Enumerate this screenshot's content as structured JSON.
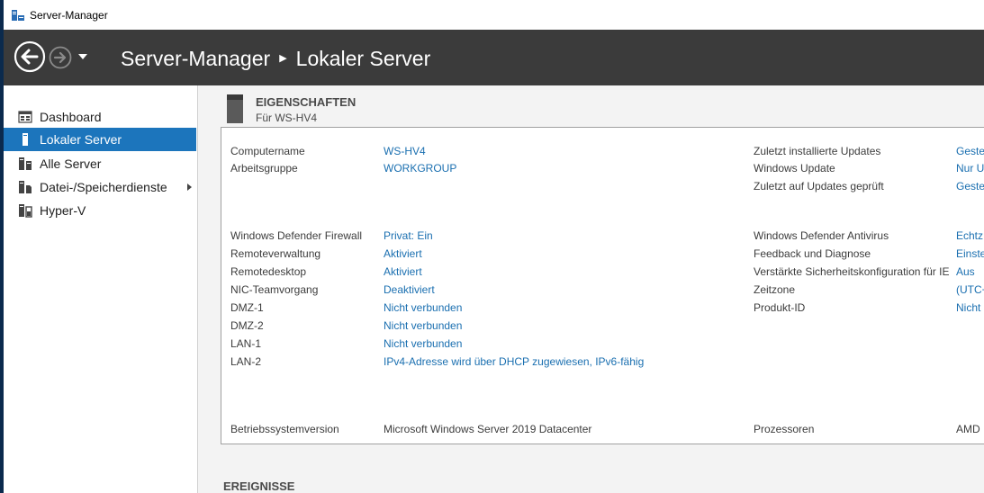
{
  "window": {
    "title": "Server-Manager"
  },
  "header": {
    "crumb_root": "Server-Manager",
    "crumb_current": "Lokaler Server"
  },
  "sidebar": {
    "items": [
      {
        "label": "Dashboard",
        "icon": "dashboard-icon"
      },
      {
        "label": "Lokaler Server",
        "icon": "local-server-icon",
        "active": true
      },
      {
        "label": "Alle Server",
        "icon": "all-servers-icon"
      },
      {
        "label": "Datei-/Speicherdienste",
        "icon": "file-storage-icon",
        "expandable": true
      },
      {
        "label": "Hyper-V",
        "icon": "hyperv-icon"
      }
    ]
  },
  "properties": {
    "title": "EIGENSCHAFTEN",
    "subtitle": "Für WS-HV4",
    "left": [
      {
        "label": "Computername",
        "value": "WS-HV4"
      },
      {
        "label": "Arbeitsgruppe",
        "value": "WORKGROUP"
      },
      {
        "label": "Windows Defender Firewall",
        "value": "Privat: Ein"
      },
      {
        "label": "Remoteverwaltung",
        "value": "Aktiviert"
      },
      {
        "label": "Remotedesktop",
        "value": "Aktiviert"
      },
      {
        "label": "NIC-Teamvorgang",
        "value": "Deaktiviert"
      },
      {
        "label": "DMZ-1",
        "value": "Nicht verbunden"
      },
      {
        "label": "DMZ-2",
        "value": "Nicht verbunden"
      },
      {
        "label": "LAN-1",
        "value": "Nicht verbunden"
      },
      {
        "label": "LAN-2",
        "value": "IPv4-Adresse wird über DHCP zugewiesen, IPv6-fähig"
      },
      {
        "label": "Betriebssystemversion",
        "value": "Microsoft Windows Server 2019 Datacenter"
      }
    ],
    "right": [
      {
        "label": "Zuletzt installierte Updates",
        "value": "Geste"
      },
      {
        "label": "Windows Update",
        "value": "Nur U"
      },
      {
        "label": "Zuletzt auf Updates geprüft",
        "value": "Geste"
      },
      {
        "label": "Windows Defender Antivirus",
        "value": "Echtz"
      },
      {
        "label": "Feedback und Diagnose",
        "value": "Einste"
      },
      {
        "label": "Verstärkte Sicherheitskonfiguration für IE",
        "value": "Aus"
      },
      {
        "label": "Zeitzone",
        "value": "(UTC+"
      },
      {
        "label": "Produkt-ID",
        "value": "Nicht"
      },
      {
        "label": "Prozessoren",
        "value": "AMD"
      }
    ]
  },
  "events": {
    "title": "EREIGNISSE"
  }
}
